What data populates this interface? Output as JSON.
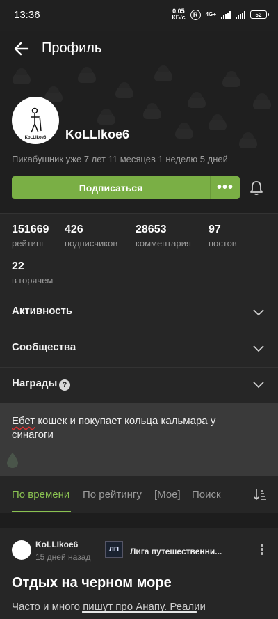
{
  "status_bar": {
    "time": "13:36",
    "net_speed_value": "0,05",
    "net_speed_unit": "КБ/с",
    "r_badge": "R",
    "network_type": "4G+",
    "battery": "52"
  },
  "header": {
    "back_icon": "arrow-left-icon",
    "title": "Профиль"
  },
  "profile": {
    "avatar_caption": "KoLLIkoe6",
    "username": "KoLLIkoe6",
    "member_since": "Пикабушник уже 7 лет 11 месяцев 1 неделю 5 дней",
    "subscribe_label": "Подписаться",
    "more_label": "•••",
    "bell_icon": "bell-icon"
  },
  "stats": [
    {
      "value": "151669",
      "label": "рейтинг"
    },
    {
      "value": "426",
      "label": "подписчиков"
    },
    {
      "value": "28653",
      "label": "комментария"
    },
    {
      "value": "97",
      "label": "постов"
    },
    {
      "value": "22",
      "label": "в горячем"
    }
  ],
  "sections": [
    {
      "label": "Активность",
      "icon": "chevron-down-icon"
    },
    {
      "label": "Сообщества",
      "icon": "chevron-down-icon"
    },
    {
      "label": "Награды",
      "icon": "chevron-down-icon",
      "help": "?"
    }
  ],
  "about": {
    "first_word": "Ебет",
    "rest": " кошек и покупает кольца кальмара у синагоги"
  },
  "tabs": [
    {
      "label": "По времени",
      "active": true
    },
    {
      "label": "По рейтингу",
      "active": false
    },
    {
      "label": "[Мое]",
      "active": false
    },
    {
      "label": "Поиск",
      "active": false
    }
  ],
  "post": {
    "author": "KoLLIkoe6",
    "time": "15 дней назад",
    "community_icon_text": "ЛП",
    "community_name": "Лига путешественни...",
    "title": "Отдых на черном море",
    "snippet": "Часто и много пишут про Анапу. Реалии"
  },
  "colors": {
    "accent": "#8ac251",
    "button": "#7aaf45",
    "background": "#262626",
    "about_bg": "#3a3a3a"
  }
}
